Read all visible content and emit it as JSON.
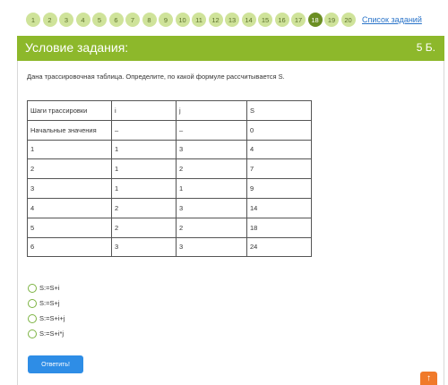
{
  "navigation": {
    "pages": [
      "1",
      "2",
      "3",
      "4",
      "5",
      "6",
      "7",
      "8",
      "9",
      "10",
      "11",
      "12",
      "13",
      "14",
      "15",
      "16",
      "17",
      "18",
      "19",
      "20"
    ],
    "active_page": "18",
    "task_list_link": "Список заданий"
  },
  "header": {
    "title": "Условие задания:",
    "points": "5 Б."
  },
  "question": {
    "text": "Дана трассировочная таблица. Определите, по какой формуле рассчитывается S."
  },
  "trace_table": {
    "rows": [
      [
        "Шаги трассировки",
        "i",
        "j",
        "S"
      ],
      [
        "Начальные значения",
        "–",
        "–",
        "0"
      ],
      [
        "1",
        "1",
        "3",
        "4"
      ],
      [
        "2",
        "1",
        "2",
        "7"
      ],
      [
        "3",
        "1",
        "1",
        "9"
      ],
      [
        "4",
        "2",
        "3",
        "14"
      ],
      [
        "5",
        "2",
        "2",
        "18"
      ],
      [
        "6",
        "3",
        "3",
        "24"
      ]
    ]
  },
  "options": [
    "S:=S+i",
    "S:=S+j",
    "S:=S+i+j",
    "S:=S+i*j"
  ],
  "answer_button": {
    "label": "Ответить!"
  },
  "corner_badge": {
    "icon": "chevron-up-icon",
    "glyph": "↑"
  },
  "colors": {
    "accent_green": "#8db82b",
    "page_button": "#cfe39a",
    "page_button_active": "#6b8e23",
    "button_blue": "#2e8de6",
    "badge_orange": "#f07a2a"
  }
}
